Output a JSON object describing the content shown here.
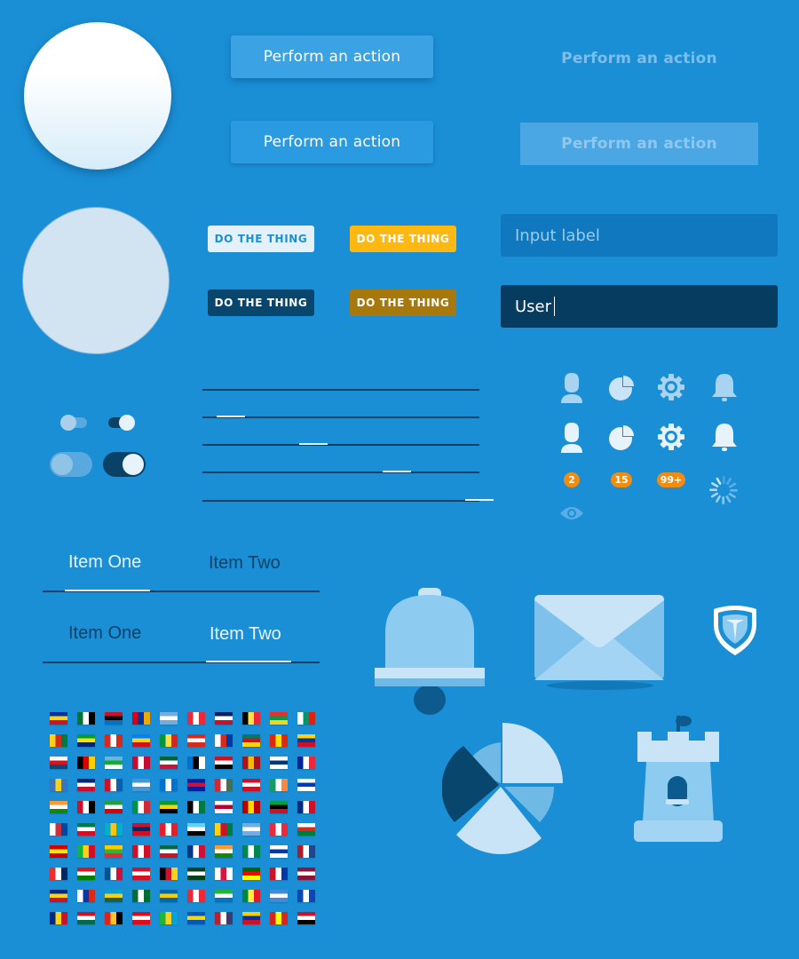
{
  "buttons": {
    "raised_label": "Perform an action",
    "flat_label": "Perform an action",
    "text_label": "Perform an action",
    "disabled_label": "Perform an action"
  },
  "small_buttons": [
    "DO THE THING",
    "DO THE THING",
    "DO THE THING",
    "DO THE THING"
  ],
  "inputs": {
    "placeholder": "Input label",
    "value": "User"
  },
  "toggles": [
    {
      "size": "small",
      "state": "off"
    },
    {
      "size": "small",
      "state": "on"
    },
    {
      "size": "large",
      "state": "off"
    },
    {
      "size": "large",
      "state": "on"
    }
  ],
  "sliders": [
    {
      "value": 0.0
    },
    {
      "value": 0.05
    },
    {
      "value": 0.35
    },
    {
      "value": 0.65
    },
    {
      "value": 0.95
    }
  ],
  "icon_names": [
    "user-icon",
    "pie-chart-icon",
    "gear-icon",
    "bell-icon",
    "eye-icon",
    "spinner-icon"
  ],
  "badges": [
    "2",
    "15",
    "99+"
  ],
  "tabs": {
    "group1": [
      "Item One",
      "Item Two"
    ],
    "group2": [
      "Item One",
      "Item Two"
    ]
  },
  "large_icons": [
    "bell-icon",
    "envelope-icon",
    "shield-icon",
    "pie-chart-icon",
    "castle-icon"
  ],
  "colors": {
    "background": "#1a8fd6",
    "accent_yellow": "#fdb812",
    "badge_orange": "#f08c0f",
    "dark_navy": "#053c5f"
  },
  "flag_rows": 10,
  "flag_cols": 10
}
